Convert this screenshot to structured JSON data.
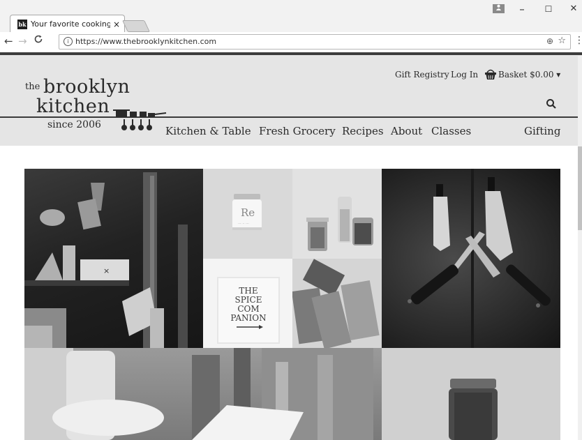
{
  "browser": {
    "tab_title": "Your favorite cooking sto",
    "favicon_text": "bk",
    "tab_close": "×",
    "url": "https://www.thebrooklynkitchen.com",
    "window_minimize": "–",
    "window_maximize": "☐",
    "window_close": "✕"
  },
  "site": {
    "logo": {
      "the": "the",
      "brooklyn": "brooklyn",
      "kitchen": "kitchen",
      "since": "since 2006"
    },
    "utility_links": {
      "gift_registry": "Gift Registry",
      "log_in": "Log In",
      "basket": "Basket $0.00 ▾"
    },
    "nav": [
      "Kitchen & Table",
      "Fresh Grocery",
      "Recipes",
      "About",
      "Classes",
      "Gifting"
    ],
    "hero": {
      "book_title_lines": [
        "THE",
        "SPICE",
        "COM",
        "PANION"
      ],
      "jar_label": "Re"
    }
  },
  "colors": {
    "header_bg": "#e5e5e5",
    "text": "#2a2a2a",
    "chrome_bg": "#f2f2f2"
  }
}
